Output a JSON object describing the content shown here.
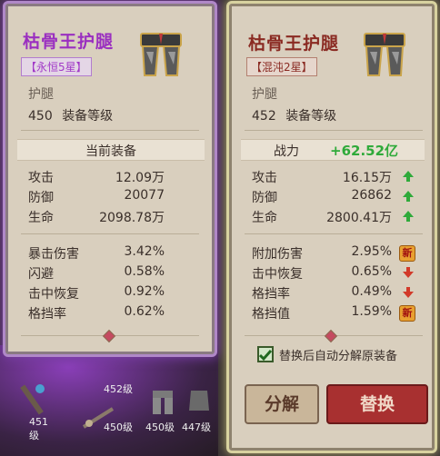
{
  "current": {
    "name": "枯骨王护腿",
    "grade": "【永恒5星】",
    "type": "护腿",
    "level_value": "450",
    "level_label": "装备等级",
    "section_label": "当前装备",
    "stats": [
      {
        "name": "攻击",
        "value": "12.09万"
      },
      {
        "name": "防御",
        "value": "20077"
      },
      {
        "name": "生命",
        "value": "2098.78万"
      }
    ],
    "extras": [
      {
        "name": "暴击伤害",
        "value": "3.42%"
      },
      {
        "name": "闪避",
        "value": "0.58%"
      },
      {
        "name": "击中恢复",
        "value": "0.92%"
      },
      {
        "name": "格挡率",
        "value": "0.62%"
      }
    ]
  },
  "candidate": {
    "name": "枯骨王护腿",
    "grade": "【混沌2星】",
    "type": "护腿",
    "level_value": "452",
    "level_label": "装备等级",
    "power_label": "战力",
    "power_value": "+62.52亿",
    "stats": [
      {
        "name": "攻击",
        "value": "16.15万",
        "trend": "up"
      },
      {
        "name": "防御",
        "value": "26862",
        "trend": "up"
      },
      {
        "name": "生命",
        "value": "2800.41万",
        "trend": "up"
      }
    ],
    "extras": [
      {
        "name": "附加伤害",
        "value": "2.95%",
        "trend": "new"
      },
      {
        "name": "击中恢复",
        "value": "0.65%",
        "trend": "down"
      },
      {
        "name": "格挡率",
        "value": "0.49%",
        "trend": "down"
      },
      {
        "name": "格挡值",
        "value": "1.59%",
        "trend": "new"
      }
    ],
    "auto_decompose_label": "替换后自动分解原装备",
    "auto_decompose_checked": true,
    "decompose_button": "分解",
    "replace_button": "替换",
    "new_badge": "新"
  },
  "inventory": {
    "items": [
      {
        "level": "451级"
      },
      {
        "level": "452级"
      },
      {
        "level": "450级"
      },
      {
        "level": "450级"
      },
      {
        "level": "447级"
      }
    ]
  },
  "colors": {
    "up_arrow": "#2faa3a",
    "down_arrow": "#d23a2a",
    "left_title": "#9a2fc0",
    "right_title": "#8a2a22"
  },
  "icons": {
    "equip": "leg-armor-icon",
    "check": "check-icon"
  }
}
